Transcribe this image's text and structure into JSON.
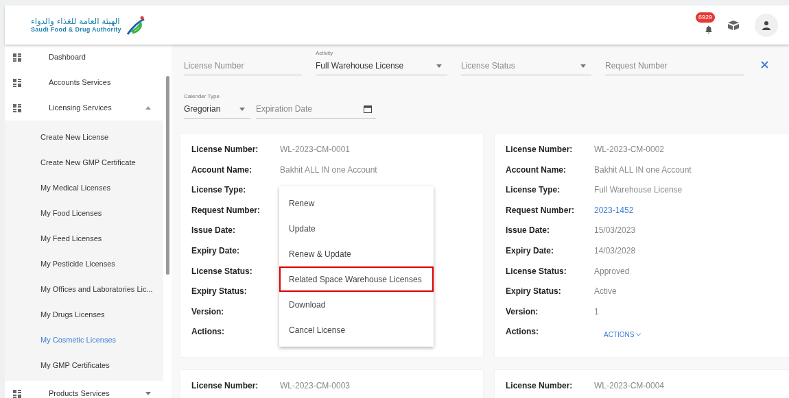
{
  "header": {
    "logo_arabic": "الهيئة العامة للغذاء والدواء",
    "logo_english": "Saudi Food & Drug Authority",
    "notification_count": "6929"
  },
  "sidebar": {
    "items": [
      {
        "kind": "link",
        "label": "Dashboard"
      },
      {
        "kind": "link",
        "label": "Accounts Services"
      },
      {
        "kind": "group",
        "label": "Licensing Services",
        "expanded": true,
        "children": [
          {
            "label": "Create New License",
            "selected": false
          },
          {
            "label": "Create New GMP Certificate",
            "selected": false
          },
          {
            "label": "My Medical Licenses",
            "selected": false
          },
          {
            "label": "My Food Licenses",
            "selected": false
          },
          {
            "label": "My Feed Licenses",
            "selected": false
          },
          {
            "label": "My Pesticide Licenses",
            "selected": false
          },
          {
            "label": "My Offices and Laboratories Lic...",
            "selected": false
          },
          {
            "label": "My Drugs Licenses",
            "selected": false
          },
          {
            "label": "My Cosmetic Licenses",
            "selected": true
          },
          {
            "label": "My GMP Certificates",
            "selected": false
          }
        ]
      },
      {
        "kind": "group",
        "label": "Products Services",
        "expanded": false
      }
    ]
  },
  "filters": [
    [
      {
        "kind": "text",
        "placeholder": "License Number"
      },
      {
        "kind": "select",
        "label": "Activity",
        "value": "Full Warehouse License"
      },
      {
        "kind": "select",
        "placeholder": "License Status"
      },
      {
        "kind": "text",
        "placeholder": "Request Number"
      }
    ],
    [
      {
        "kind": "select",
        "label": "Calender Type",
        "value": "Gregorian"
      },
      {
        "kind": "date",
        "placeholder": "Expiration Date"
      }
    ]
  ],
  "cards": [
    {
      "rows": [
        {
          "kind": "text",
          "label": "License Number:",
          "value": "WL-2023-CM-0001"
        },
        {
          "kind": "text",
          "label": "Account Name:",
          "value": "Bakhit ALL IN one Account"
        },
        {
          "kind": "text",
          "label": "License Type:"
        },
        {
          "kind": "text",
          "label": "Request Number:"
        },
        {
          "kind": "text",
          "label": "Issue Date:"
        },
        {
          "kind": "text",
          "label": "Expiry Date:"
        },
        {
          "kind": "text",
          "label": "License Status:"
        },
        {
          "kind": "text",
          "label": "Expiry Status:"
        },
        {
          "kind": "text",
          "label": "Version:"
        },
        {
          "kind": "text",
          "label": "Actions:"
        }
      ],
      "menu": [
        {
          "label": "Renew",
          "highlighted": false
        },
        {
          "label": "Update",
          "highlighted": false
        },
        {
          "label": "Renew & Update",
          "highlighted": false
        },
        {
          "label": "Related Space Warehouse Licenses",
          "highlighted": true
        },
        {
          "label": "Download",
          "highlighted": false
        },
        {
          "label": "Cancel License",
          "highlighted": false
        }
      ]
    },
    {
      "rows": [
        {
          "kind": "text",
          "label": "License Number:",
          "value": "WL-2023-CM-0002"
        },
        {
          "kind": "text",
          "label": "Account Name:",
          "value": "Bakhit ALL IN one Account"
        },
        {
          "kind": "text",
          "label": "License Type:",
          "value": "Full Warehouse License"
        },
        {
          "kind": "link",
          "label": "Request Number:",
          "value": "2023-1452"
        },
        {
          "kind": "text",
          "label": "Issue Date:",
          "value": "15/03/2023"
        },
        {
          "kind": "text",
          "label": "Expiry Date:",
          "value": "14/03/2028"
        },
        {
          "kind": "text",
          "label": "License Status:",
          "value": "Approved"
        },
        {
          "kind": "text",
          "label": "Expiry Status:",
          "value": "Active"
        },
        {
          "kind": "text",
          "label": "Version:",
          "value": "1"
        },
        {
          "kind": "actions",
          "label": "Actions:",
          "value": "ACTIONS"
        }
      ]
    },
    {
      "rows": [
        {
          "kind": "text",
          "label": "License Number:",
          "value": "WL-2023-CM-0003"
        }
      ]
    },
    {
      "rows": [
        {
          "kind": "text",
          "label": "License Number:",
          "value": "WL-2023-CM-0004"
        }
      ]
    }
  ]
}
